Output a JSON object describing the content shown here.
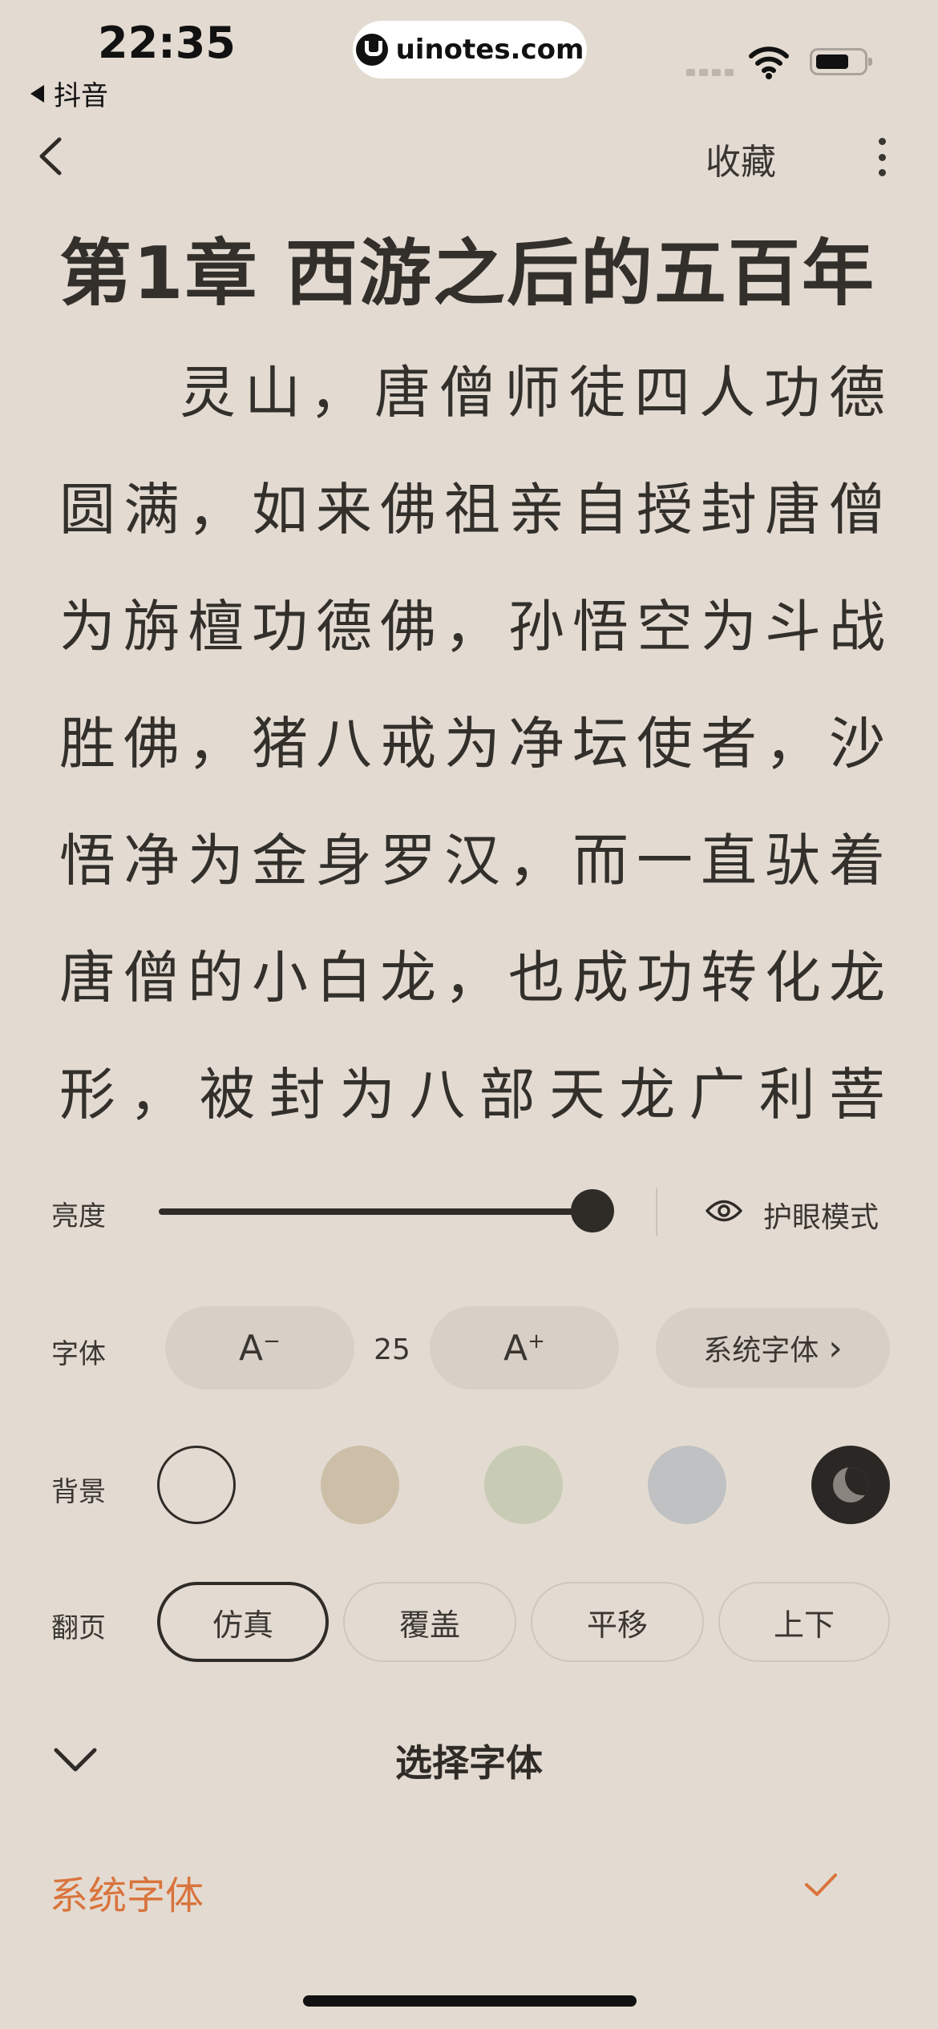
{
  "status_bar": {
    "time": "22:35",
    "back_app": "抖音",
    "watermark": "uinotes.com",
    "icons": [
      "signal-dots-icon",
      "wifi-icon",
      "battery-icon"
    ]
  },
  "nav": {
    "favorite": "收藏",
    "icons": [
      "chevron-left-icon",
      "more-vertical-icon"
    ]
  },
  "chapter": {
    "title": "第1章  西游之后的五百年",
    "lines": [
      "灵山，唐僧师徒四人功德",
      "圆满，如来佛祖亲自授封唐僧",
      "为旃檀功德佛，孙悟空为斗战",
      "胜佛，猪八戒为净坛使者，沙",
      "悟净为金身罗汉，而一直驮着",
      "唐僧的小白龙，也成功转化龙",
      "形，被封为八部天龙广利菩"
    ]
  },
  "settings": {
    "brightness": {
      "label": "亮度",
      "level": 0.96,
      "eye_mode": "护眼模式"
    },
    "font": {
      "label": "字体",
      "decrease": "A",
      "decrease_mark": "−",
      "size": "25",
      "increase": "A",
      "increase_mark": "+",
      "family": "系统字体",
      "family_arrow": "›"
    },
    "background": {
      "label": "背景",
      "swatches": [
        "#ffffff",
        "#cdbfa7",
        "#c8ccb4",
        "#bfc1c3",
        "#2b2724"
      ]
    },
    "page_turn": {
      "label": "翻页",
      "options": [
        "仿真",
        "覆盖",
        "平移",
        "上下"
      ],
      "selected": "仿真"
    }
  },
  "font_picker": {
    "title": "选择字体",
    "options": [
      "系统字体"
    ],
    "selected": "系统字体",
    "accent_color": "#d9743d"
  }
}
